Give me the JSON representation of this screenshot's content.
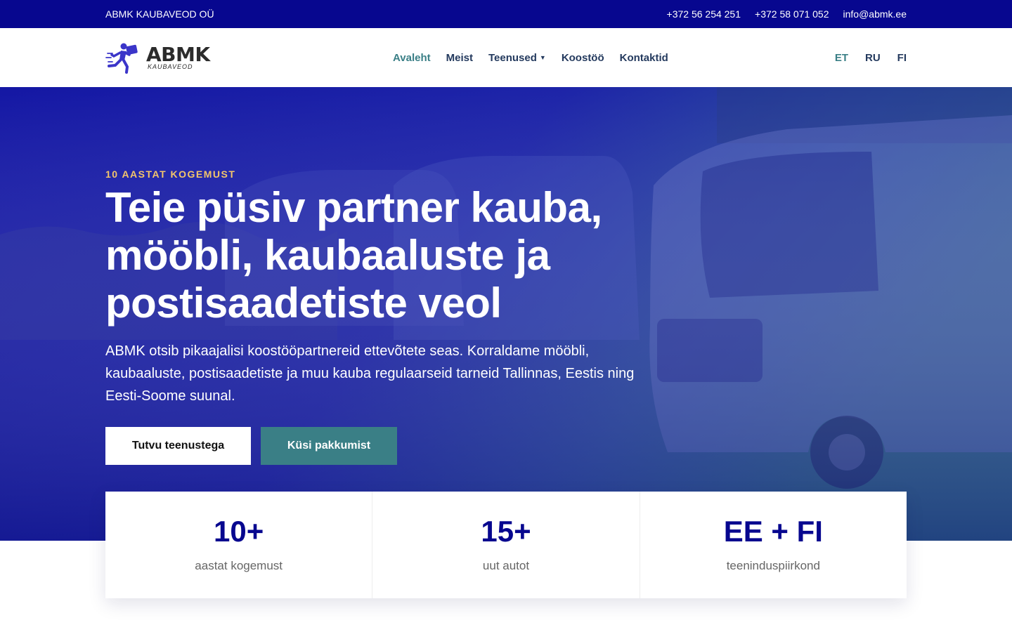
{
  "topbar": {
    "company": "ABMK KAUBAVEOD OÜ",
    "phone1": "+372 56 254 251",
    "phone2": "+372 58 071 052",
    "email": "info@abmk.ee"
  },
  "logo": {
    "word": "ABMK",
    "sub": "KAUBAVEOD"
  },
  "nav": {
    "items": [
      {
        "label": "Avaleht"
      },
      {
        "label": "Meist"
      },
      {
        "label": "Teenused"
      },
      {
        "label": "Koostöö"
      },
      {
        "label": "Kontaktid"
      }
    ],
    "active": "Avaleht"
  },
  "languages": [
    "ET",
    "RU",
    "FI"
  ],
  "active_language": "ET",
  "hero": {
    "eyebrow": "10 AASTAT KOGEMUST",
    "title": "Teie püsiv partner kauba, mööbli, kaubaaluste ja postisaadetiste veol",
    "text": "ABMK otsib pikaajalisi koostööpartnereid ettevõtete seas. Korraldame mööbli, kaubaaluste, postisaadetiste ja muu kauba regulaarseid tarneid Tallinnas, Eestis ning Eesti-Soome suunal.",
    "primary_button": "Tutvu teenustega",
    "secondary_button": "Küsi pakkumist"
  },
  "stats": [
    {
      "value": "10+",
      "label": "aastat kogemust"
    },
    {
      "value": "15+",
      "label": "uut autot"
    },
    {
      "value": "EE + FI",
      "label": "teeninduspiirkond"
    }
  ],
  "colors": {
    "topbar": "#07078f",
    "hero_overlay": "#1a1f9e",
    "accent_teal": "#3a7f86",
    "eyebrow": "#f3c56b",
    "nav_text": "#243a5e",
    "stat_value": "#07078f"
  }
}
